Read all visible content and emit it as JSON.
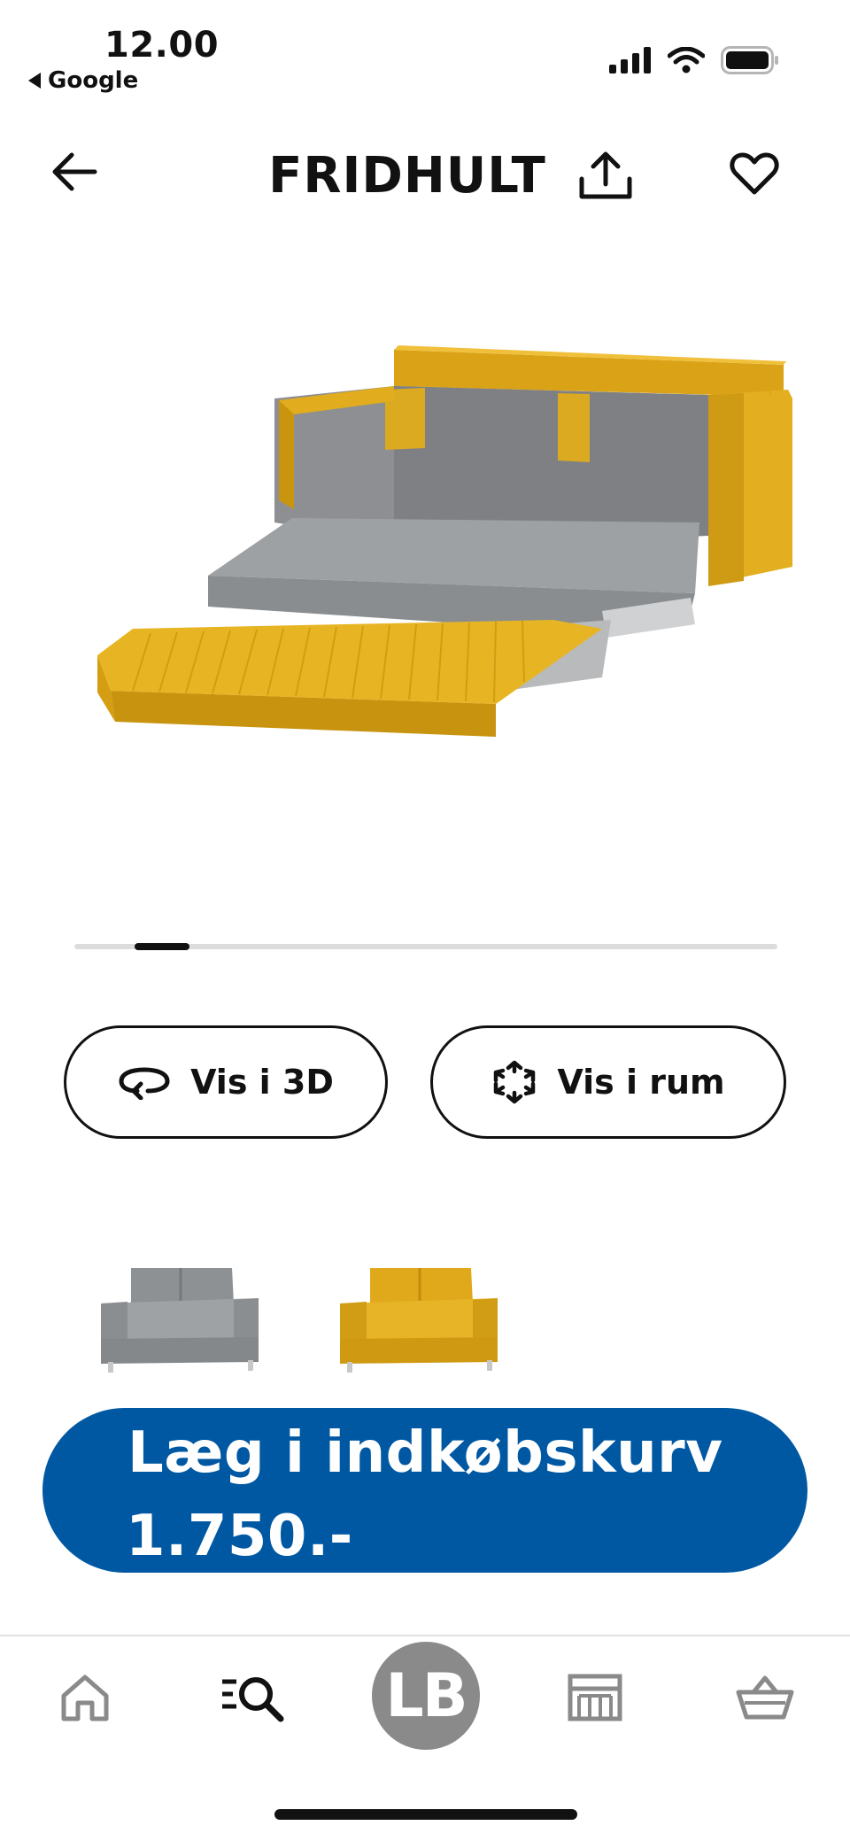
{
  "status_bar": {
    "time": "12.00",
    "back_app": "Google",
    "icons": [
      "cellular-signal-icon",
      "wifi-icon",
      "battery-icon"
    ]
  },
  "header": {
    "title": "FRIDHULT",
    "icons": [
      "back-arrow-icon",
      "share-icon",
      "heart-icon"
    ]
  },
  "product": {
    "image": "sofa-bed-yellow-unfolded",
    "carousel": {
      "current": 1
    }
  },
  "actions": {
    "view_3d": "Vis i 3D",
    "view_room": "Vis i rum"
  },
  "variants": [
    {
      "color": "grey",
      "swatch": "#8f9396",
      "selected": false
    },
    {
      "color": "yellow",
      "swatch": "#e3ac1a",
      "selected": true
    }
  ],
  "cart": {
    "label": "Læg i indkøbskurv",
    "price": "1.750.-"
  },
  "bottom_nav": {
    "items": [
      "home-icon",
      "search-icon",
      "stores-icon",
      "basket-icon"
    ],
    "avatar_initials": "LB"
  },
  "colors": {
    "brand_blue": "#0058a3",
    "fabric_yellow": "#e3ac1a",
    "fabric_grey": "#8f9396",
    "nav_grey": "#8a8a8a"
  }
}
